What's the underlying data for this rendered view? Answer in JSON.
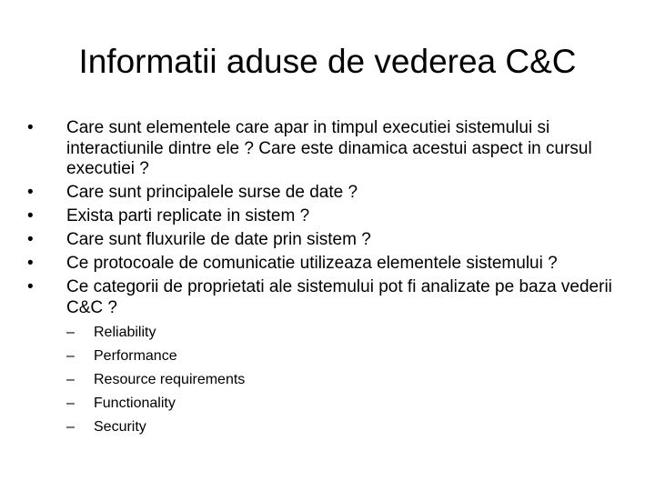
{
  "slide": {
    "title": "Informatii aduse de vederea C&C",
    "bullet_marker": "•",
    "sub_marker": "–",
    "bullets": [
      {
        "text": "Care sunt elementele care apar in timpul executiei sistemului si interactiunile dintre ele ? Care este dinamica acestui aspect in cursul executiei ?"
      },
      {
        "text": "Care sunt principalele surse de date ?"
      },
      {
        "text": "Exista parti replicate in sistem ?"
      },
      {
        "text": "Care sunt fluxurile de date prin sistem ?"
      },
      {
        "text": "Ce protocoale de comunicatie utilizeaza elementele sistemului ?"
      },
      {
        "text": "Ce categorii de proprietati ale sistemului pot fi analizate pe baza vederii C&C ?",
        "sub_items": [
          "Reliability",
          "Performance",
          "Resource requirements",
          "Functionality",
          "Security"
        ]
      }
    ]
  }
}
